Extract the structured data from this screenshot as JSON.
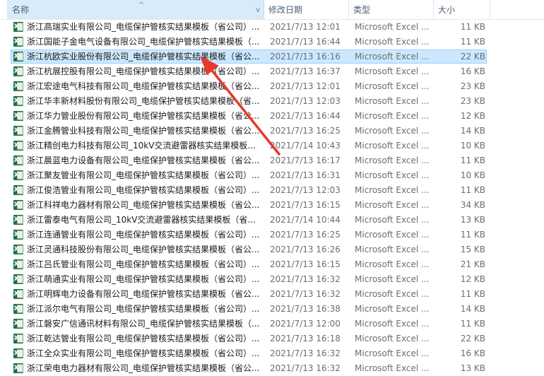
{
  "header": {
    "name": "名称",
    "date": "修改日期",
    "type": "类型",
    "size": "大小",
    "sort_caret": "^",
    "name_chevron": "v"
  },
  "accent": {
    "selection_bg": "#cce8ff",
    "selection_border": "#99d1ff",
    "arrow": "#e8392b",
    "excel_green": "#1d7244"
  },
  "files": [
    {
      "name": "浙江高瑞实业有限公司_电缆保护管核实结果模板（省公司）...",
      "date": "2021/7/13 12:01",
      "type": "Microsoft Excel ...",
      "size": "11 KB",
      "icon": "excel-icon"
    },
    {
      "name": "浙江国能子金电气设备有限公司_电缆保护管核实结果模板（...",
      "date": "2021/7/13 16:44",
      "type": "Microsoft Excel ...",
      "size": "11 KB",
      "icon": "excel-icon"
    },
    {
      "name": "浙江杭欧实业股份有限公司_电缆保护管核实结果模板（省公...",
      "date": "2021/7/13 16:16",
      "type": "Microsoft Excel ...",
      "size": "22 KB",
      "icon": "excel-icon",
      "selected": true
    },
    {
      "name": "浙江杭展控股有限公司_电缆保护管核实结果模板（省公司）...",
      "date": "2021/7/13 16:37",
      "type": "Microsoft Excel ...",
      "size": "16 KB",
      "icon": "excel-icon"
    },
    {
      "name": "浙江宏途电气科技有限公司_电缆保护管核实结果模板（省公...",
      "date": "2021/7/13 12:01",
      "type": "Microsoft Excel ...",
      "size": "23 KB",
      "icon": "excel-icon"
    },
    {
      "name": "浙江华丰新材料股份有限公司_电缆保护管核实结果模板（省...",
      "date": "2021/7/13 12:03",
      "type": "Microsoft Excel ...",
      "size": "23 KB",
      "icon": "excel-icon"
    },
    {
      "name": "浙江华力管业股份有限公司_电缆保护管核实结果模板（省公...",
      "date": "2021/7/13 16:44",
      "type": "Microsoft Excel ...",
      "size": "12 KB",
      "icon": "excel-icon"
    },
    {
      "name": "浙江金腾管业科技有限公司_电缆保护管核实结果模板（省公...",
      "date": "2021/7/13 16:25",
      "type": "Microsoft Excel ...",
      "size": "14 KB",
      "icon": "excel-icon"
    },
    {
      "name": "浙江精创电力科技有限公司_10kV交流避雷器核实结果模板...",
      "date": "2021/7/14 10:43",
      "type": "Microsoft Excel ...",
      "size": "10 KB",
      "icon": "excel-icon"
    },
    {
      "name": "浙江晨蓝电力设备有限公司_电缆保护管核实结果模板（省公...",
      "date": "2021/7/13 16:17",
      "type": "Microsoft Excel ...",
      "size": "11 KB",
      "icon": "excel-icon"
    },
    {
      "name": "浙江聚友管业有限公司_电缆保护管核实结果模板（省公司）...",
      "date": "2021/7/13 16:31",
      "type": "Microsoft Excel ...",
      "size": "10 KB",
      "icon": "excel-icon"
    },
    {
      "name": "浙江俊浩管业有限公司_电缆保护管核实结果模板（省公司）...",
      "date": "2021/7/13 12:03",
      "type": "Microsoft Excel ...",
      "size": "11 KB",
      "icon": "excel-icon"
    },
    {
      "name": "浙江科祥电力器材有限公司_电缆保护管核实结果模板（省公...",
      "date": "2021/7/13 16:15",
      "type": "Microsoft Excel ...",
      "size": "34 KB",
      "icon": "excel-icon"
    },
    {
      "name": "浙江雷泰电气有限公司_10kV交流避雷器核实结果模板（省...",
      "date": "2021/7/14 10:44",
      "type": "Microsoft Excel ...",
      "size": "13 KB",
      "icon": "excel-icon"
    },
    {
      "name": "浙江连通管业有限公司_电缆保护管核实结果模板（省公司）...",
      "date": "2021/7/13 16:25",
      "type": "Microsoft Excel ...",
      "size": "11 KB",
      "icon": "excel-icon"
    },
    {
      "name": "浙江灵通科技股份有限公司_电缆保护管核实结果模板（省公...",
      "date": "2021/7/13 16:26",
      "type": "Microsoft Excel ...",
      "size": "15 KB",
      "icon": "excel-icon"
    },
    {
      "name": "浙江吕氏管业有限公司_电缆保护管核实结果模板（省公司）...",
      "date": "2021/7/13 16:15",
      "type": "Microsoft Excel ...",
      "size": "21 KB",
      "icon": "excel-icon"
    },
    {
      "name": "浙江萌通实业有限公司_电缆保护管核实结果模板（省公司）...",
      "date": "2021/7/13 16:32",
      "type": "Microsoft Excel ...",
      "size": "12 KB",
      "icon": "excel-icon"
    },
    {
      "name": "浙江明辉电力设备有限公司_电缆保护管核实结果模板（省公...",
      "date": "2021/7/13 16:32",
      "type": "Microsoft Excel ...",
      "size": "11 KB",
      "icon": "excel-icon"
    },
    {
      "name": "浙江派尔电气有限公司_电缆保护管核实结果模板（省公司）...",
      "date": "2021/7/13 16:38",
      "type": "Microsoft Excel ...",
      "size": "14 KB",
      "icon": "excel-icon"
    },
    {
      "name": "浙江磐安广信通讯材料有限公司_电缆保护管核实结果模板（...",
      "date": "2021/7/13 12:00",
      "type": "Microsoft Excel ...",
      "size": "11 KB",
      "icon": "excel-icon"
    },
    {
      "name": "浙江乾达管业有限公司_电缆保护管核实结果模板（省公司）...",
      "date": "2021/7/13 16:18",
      "type": "Microsoft Excel ...",
      "size": "22 KB",
      "icon": "excel-icon"
    },
    {
      "name": "浙江全众实业有限公司_电缆保护管核实结果模板（省公司）...",
      "date": "2021/7/13 16:32",
      "type": "Microsoft Excel ...",
      "size": "16 KB",
      "icon": "excel-icon"
    },
    {
      "name": "浙江荣电电力器材有限公司_电缆保护管核实结果模板（省公...",
      "date": "2021/7/13 16:32",
      "type": "Microsoft Excel ...",
      "size": "13 KB",
      "icon": "excel-icon"
    }
  ]
}
